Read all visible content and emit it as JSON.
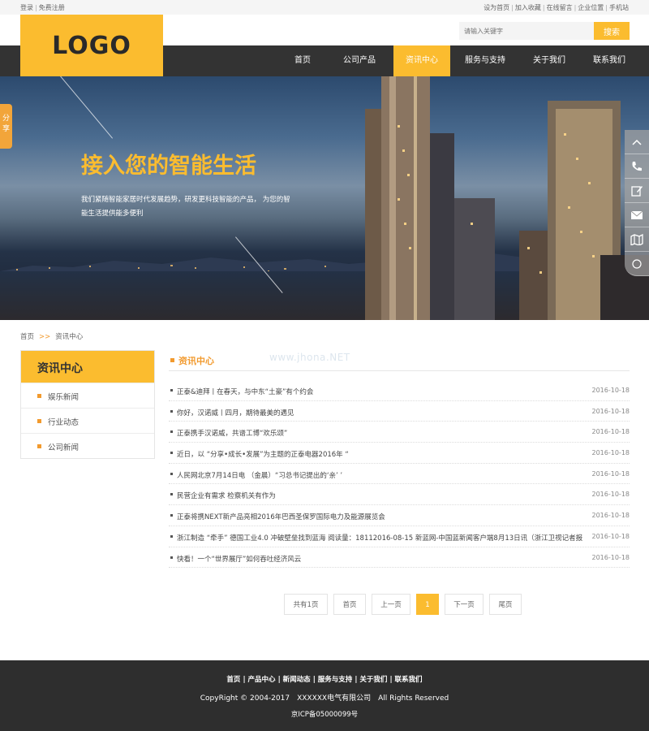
{
  "topbar": {
    "login": "登录",
    "register": "免费注册",
    "set_home": "设为首页",
    "favorite": "加入收藏",
    "message": "在线留言",
    "location": "企业位置",
    "mobile": "手机站"
  },
  "header": {
    "logo_text": "LOGO",
    "search_placeholder": "请输入关键字",
    "search_button": "搜索"
  },
  "nav": {
    "items": [
      "首页",
      "公司产品",
      "资讯中心",
      "服务与支持",
      "关于我们",
      "联系我们"
    ],
    "active": "资讯中心"
  },
  "banner": {
    "title": "接入您的智能生活",
    "desc": "我们紧随智能家居时代发展趋势，研发更科技智能的产品， 为您的智能生活提供能多便利"
  },
  "share_tab": "分享",
  "side_tools": [
    "chevron-up-icon",
    "phone-icon",
    "edit-icon",
    "mail-icon",
    "map-icon",
    "top-icon"
  ],
  "breadcrumb": {
    "home": "首页",
    "arrow": ">>",
    "current": "资讯中心"
  },
  "sidebar": {
    "title": "资讯中心",
    "items": [
      "娱乐新闻",
      "行业动态",
      "公司新闻"
    ]
  },
  "main": {
    "section_title": "资讯中心",
    "watermark": "www.jhona.NET",
    "news": [
      {
        "title": "正泰&迪拜丨在春天，与中东“土豪”有个约会",
        "date": "2016-10-18"
      },
      {
        "title": "你好，汉诺威丨四月，期待最美的遇见",
        "date": "2016-10-18"
      },
      {
        "title": "正泰携手汉诺威，共谱工博“欢乐颂”",
        "date": "2016-10-18"
      },
      {
        "title": "近日，以 “分享•成长•发展”为主题的正泰电器2016年 “",
        "date": "2016-10-18"
      },
      {
        "title": "人民网北京7月14日电 （金晨）“习总书记提出的‘亲’ ’",
        "date": "2016-10-18"
      },
      {
        "title": "民营企业有需求 检察机关有作为",
        "date": "2016-10-18"
      },
      {
        "title": "正泰将携NEXT新产品亮相2016年巴西圣保罗国际电力及能源展览会",
        "date": "2016-10-18"
      },
      {
        "title": "浙江制造 “牵手” 德国工业4.0 冲破壁垒找到蓝海 阅读量：18112016-08-15 新蓝网-中国蓝新闻客户端8月13日讯（浙江卫视记者报",
        "date": "2016-10-18"
      },
      {
        "title": "快看！一个“世界展厅”如何吞吐经济风云",
        "date": "2016-10-18"
      }
    ]
  },
  "pager": {
    "total": "共有1页",
    "first": "首页",
    "prev": "上一页",
    "current": "1",
    "next": "下一页",
    "last": "尾页"
  },
  "footer": {
    "links": [
      "首页",
      "产品中心",
      "新闻动态",
      "服务与支持",
      "关于我们",
      "联系我们"
    ],
    "copyright": "CopyRight © 2004-2017　XXXXXX电气有限公司　All Rights Reserved",
    "icp": "京ICP备05000099号"
  },
  "colors": {
    "accent": "#fbbc2f",
    "accent_dark": "#f29a2e",
    "nav_bg": "#333333",
    "footer_bg": "#2e2e2e"
  }
}
